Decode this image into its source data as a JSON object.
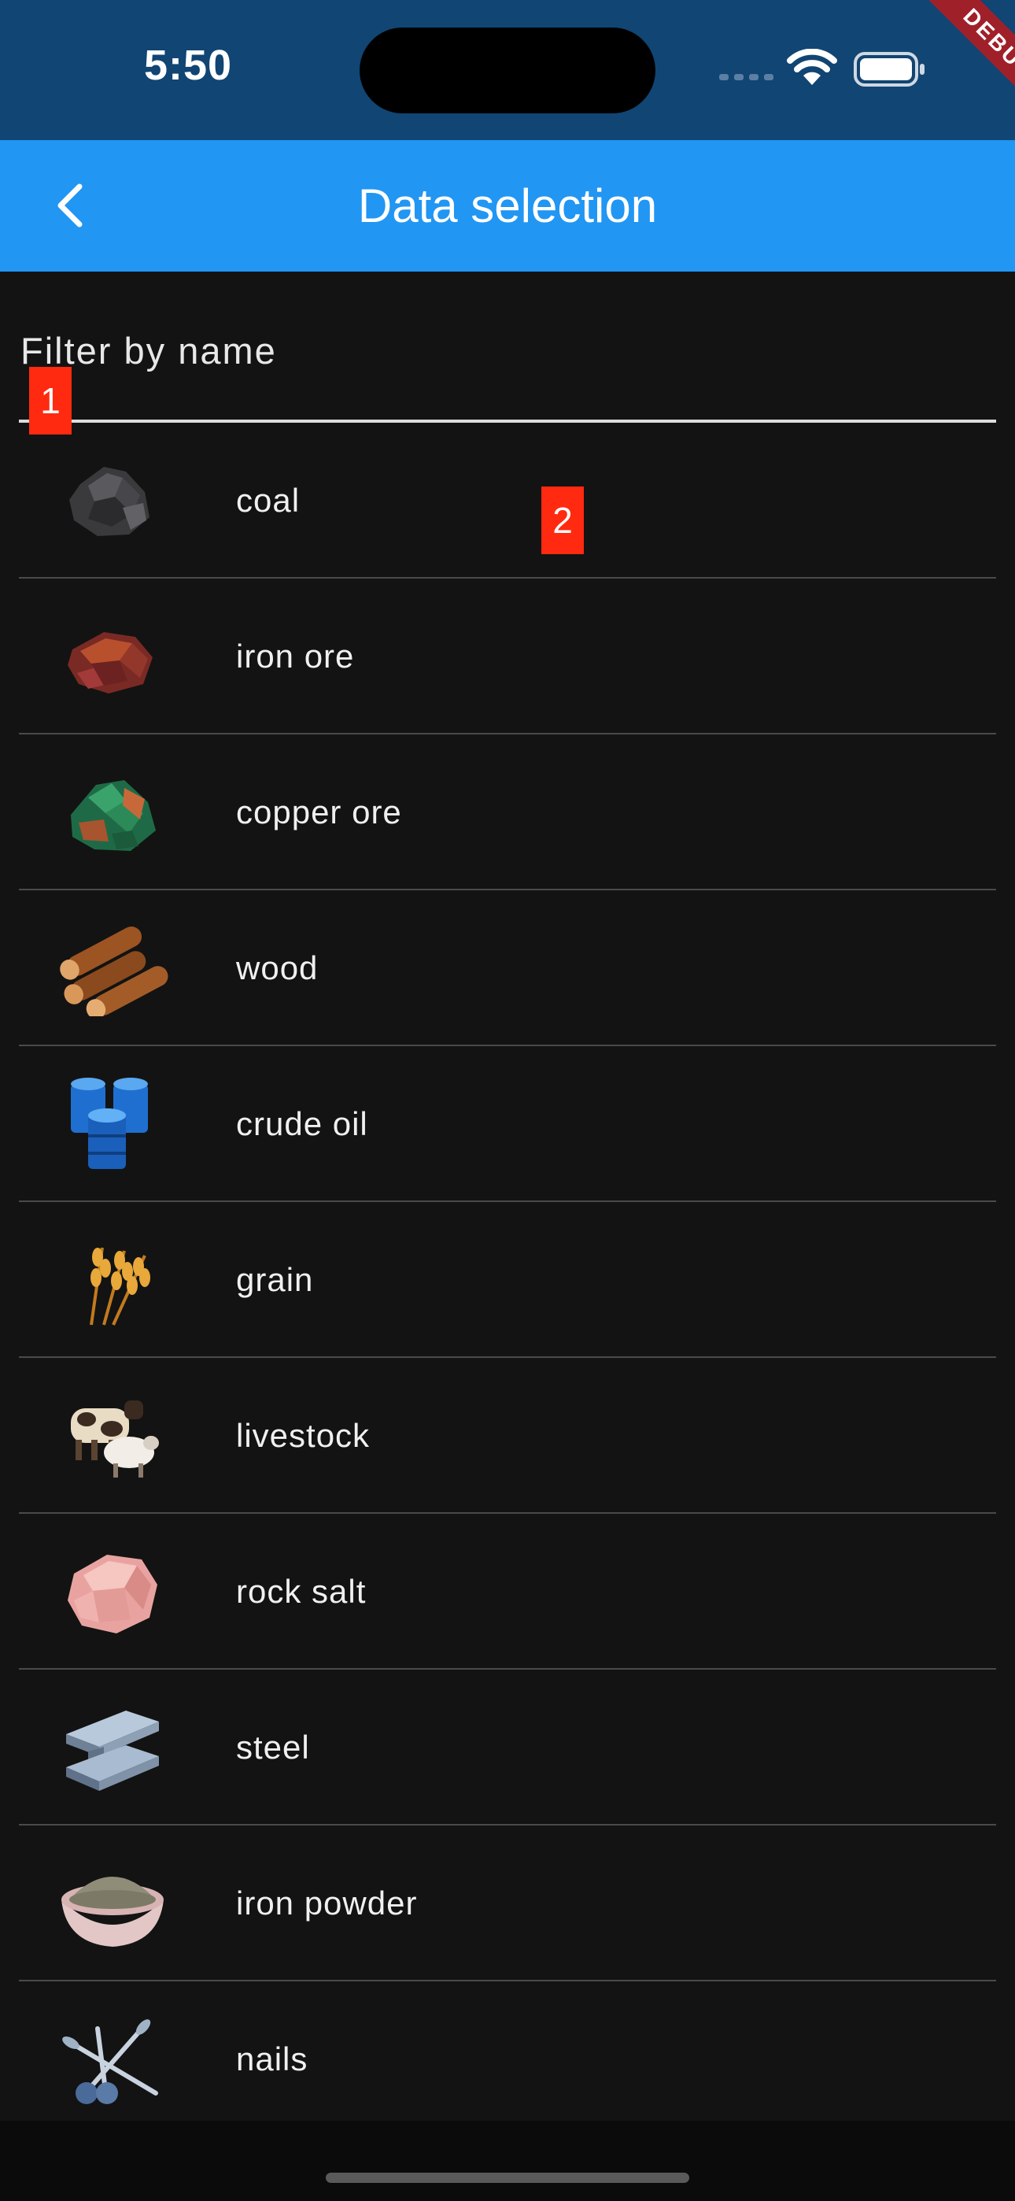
{
  "status_bar": {
    "time": "5:50",
    "debug_label": "DEBUG",
    "icons": [
      "cellular-dots-icon",
      "wifi-icon",
      "battery-icon"
    ]
  },
  "app_bar": {
    "title": "Data selection",
    "back_icon": "chevron-left-icon"
  },
  "filter": {
    "label": "Filter by name"
  },
  "markers": [
    "1",
    "2"
  ],
  "items": [
    {
      "label": "coal",
      "icon": "coal-icon"
    },
    {
      "label": "iron ore",
      "icon": "iron-ore-icon"
    },
    {
      "label": "copper ore",
      "icon": "copper-ore-icon"
    },
    {
      "label": "wood",
      "icon": "wood-icon"
    },
    {
      "label": "crude oil",
      "icon": "crude-oil-icon"
    },
    {
      "label": "grain",
      "icon": "grain-icon"
    },
    {
      "label": "livestock",
      "icon": "livestock-icon"
    },
    {
      "label": "rock salt",
      "icon": "rock-salt-icon"
    },
    {
      "label": "steel",
      "icon": "steel-icon"
    },
    {
      "label": "iron powder",
      "icon": "iron-powder-icon"
    },
    {
      "label": "nails",
      "icon": "nails-icon"
    }
  ],
  "colors": {
    "status_bar": "#114573",
    "app_bar": "#2196f3",
    "background": "#131313",
    "marker": "#ff2a0f",
    "debug_banner": "#a0202a"
  }
}
